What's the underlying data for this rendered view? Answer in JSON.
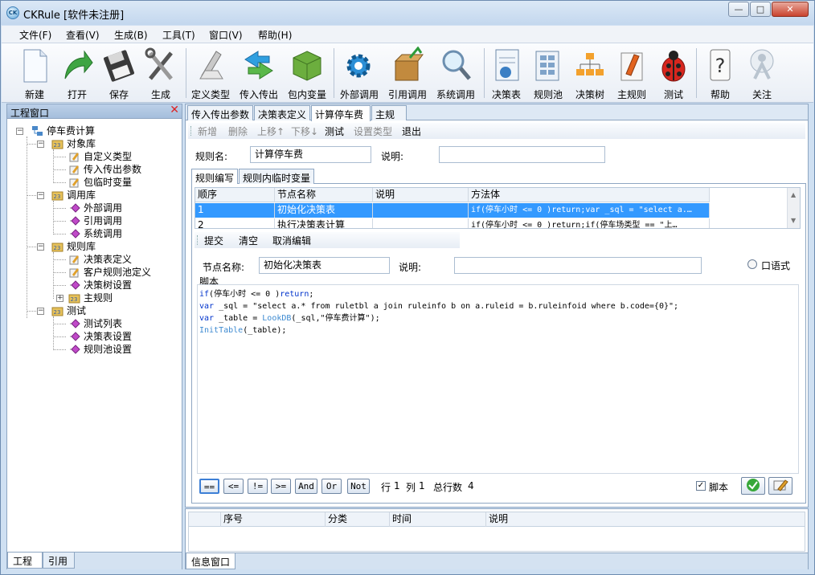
{
  "window": {
    "title": "CKRule [软件未注册]",
    "app_icon_text": "CK"
  },
  "menu": [
    "文件(F)",
    "查看(V)",
    "生成(B)",
    "工具(T)",
    "窗口(V)",
    "帮助(H)"
  ],
  "toolbar": [
    {
      "label": "新建",
      "icon": "new-file-icon"
    },
    {
      "label": "打开",
      "icon": "open-arrow-icon"
    },
    {
      "label": "保存",
      "icon": "floppy-disk-icon"
    },
    {
      "label": "生成",
      "icon": "build-tools-icon"
    },
    {
      "label": "定义类型",
      "icon": "define-type-icon"
    },
    {
      "label": "传入传出",
      "icon": "in-out-arrows-icon"
    },
    {
      "label": "包内变量",
      "icon": "package-variable-icon"
    },
    {
      "label": "外部调用",
      "icon": "external-call-gear-icon"
    },
    {
      "label": "引用调用",
      "icon": "reference-call-box-icon"
    },
    {
      "label": "系统调用",
      "icon": "system-call-magnifier-icon"
    },
    {
      "label": "决策表",
      "icon": "decision-table-icon"
    },
    {
      "label": "规则池",
      "icon": "rule-pool-icon"
    },
    {
      "label": "决策树",
      "icon": "decision-tree-icon"
    },
    {
      "label": "主规则",
      "icon": "main-rule-icon"
    },
    {
      "label": "测试",
      "icon": "ladybug-test-icon"
    },
    {
      "label": "帮助",
      "icon": "help-question-icon"
    },
    {
      "label": "关注",
      "icon": "follow-person-icon"
    }
  ],
  "left_panel": {
    "title": "工程窗口",
    "tree": {
      "root": "停车费计算",
      "groups": [
        {
          "label": "对象库",
          "children": [
            "自定义类型",
            "传入传出参数",
            "包临时变量"
          ]
        },
        {
          "label": "调用库",
          "children": [
            "外部调用",
            "引用调用",
            "系统调用"
          ]
        },
        {
          "label": "规则库",
          "children": [
            "决策表定义",
            "客户规则池定义",
            "决策树设置",
            "主规则"
          ]
        },
        {
          "label": "测试",
          "children": [
            "测试列表",
            "决策表设置",
            "规则池设置"
          ]
        }
      ]
    },
    "tabs": [
      "工程",
      "引用"
    ]
  },
  "main": {
    "doc_tabs": [
      "传入传出参数",
      "决策表定义",
      "计算停车费",
      "主规则"
    ],
    "active_doc_tab": "计算停车费",
    "rule_toolbar": [
      "新增",
      "删除",
      "上移↑",
      "下移↓",
      "测试",
      "设置类型",
      "退出"
    ],
    "rule_name_label": "规则名:",
    "rule_name_value": "计算停车费",
    "desc_label": "说明:",
    "desc_value": "",
    "sub_tabs": [
      "规则编写",
      "规则内临时变量"
    ],
    "grid": {
      "columns": [
        "顺序",
        "节点名称",
        "说明",
        "方法体"
      ],
      "rows": [
        [
          "1",
          "初始化决策表",
          "",
          "if(停车小时 <= 0 )return;var _sql = \"select a.…"
        ],
        [
          "2",
          "执行决策表计算",
          "",
          "if(停车小时 <= 0 )return;if(停车场类型 == \"上…"
        ]
      ]
    },
    "node_toolbar": [
      "提交",
      "清空",
      "取消编辑"
    ],
    "node_name_label": "节点名称:",
    "node_name_value": "初始化决策表",
    "node_desc_label": "说明:",
    "node_desc_value": "",
    "oral_option": "口语式",
    "script_label": "脚本",
    "script_lines": [
      "if(停车小时 <= 0 )return;",
      "var _sql = \"select a.* from ruletbl a join ruleinfo b on a.ruleid = b.ruleinfoid where b.code={0}\";",
      "var _table = LookDB(_sql,\"停车费计算\");",
      "InitTable(_table);"
    ],
    "operators": [
      "==",
      "<=",
      "!=",
      ">=",
      "And",
      "Or",
      "Not"
    ],
    "status": {
      "line_label": "行",
      "line": "1",
      "col_label": "列",
      "col": "1",
      "total_label": "总行数",
      "total": "4"
    },
    "script_checkbox": "脚本"
  },
  "info_panel": {
    "columns": [
      "序号",
      "分类",
      "时间",
      "说明"
    ],
    "tab": "信息窗口"
  },
  "colors": {
    "selection": "#3399ff",
    "accent": "#c3d7ee"
  }
}
